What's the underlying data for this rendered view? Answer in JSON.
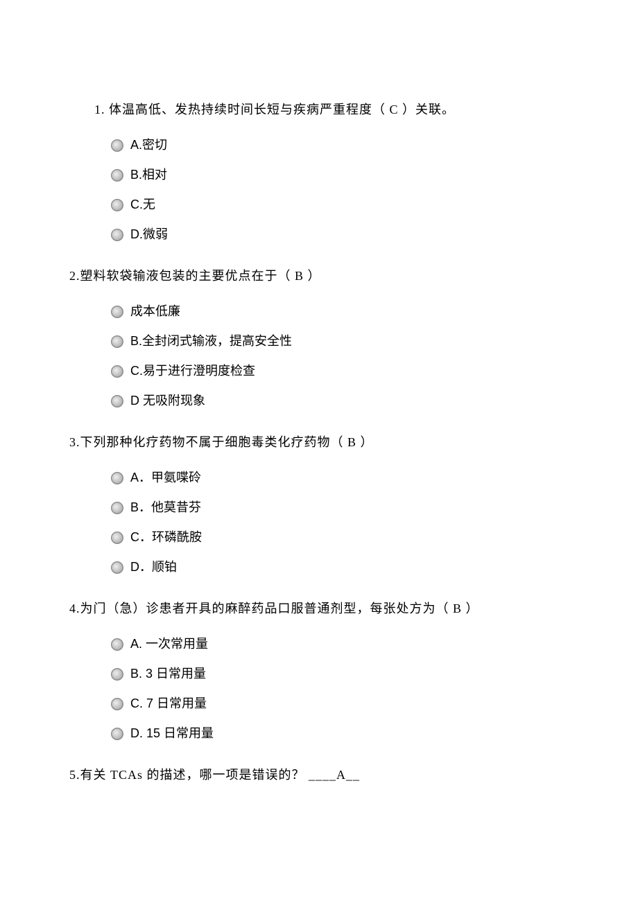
{
  "questions": [
    {
      "text": "1. 体温高低、发热持续时间长短与疾病严重程度（ C ）关联。",
      "options": [
        "A.密切",
        "B.相对",
        "C.无",
        "D.微弱"
      ]
    },
    {
      "text": "2.塑料软袋输液包装的主要优点在于（   B ）",
      "options": [
        "成本低廉",
        "B.全封闭式输液，提高安全性",
        "C.易于进行澄明度检查",
        "D 无吸附现象"
      ]
    },
    {
      "text": "3.下列那种化疗药物不属于细胞毒类化疗药物（   B ）",
      "options": [
        "A．甲氨喋砱",
        "B．他莫昔芬",
        "C．环磷酰胺",
        "D．顺铂"
      ]
    },
    {
      "text": "4.为门（急）诊患者开具的麻醉药品口服普通剂型，每张处方为（    B   ）",
      "options": [
        "A. 一次常用量",
        "B. 3 日常用量",
        "C. 7 日常用量",
        "D. 15 日常用量"
      ]
    },
    {
      "text": "5.有关 TCAs 的描述，哪一项是错误的？   ____A__",
      "options": []
    }
  ]
}
